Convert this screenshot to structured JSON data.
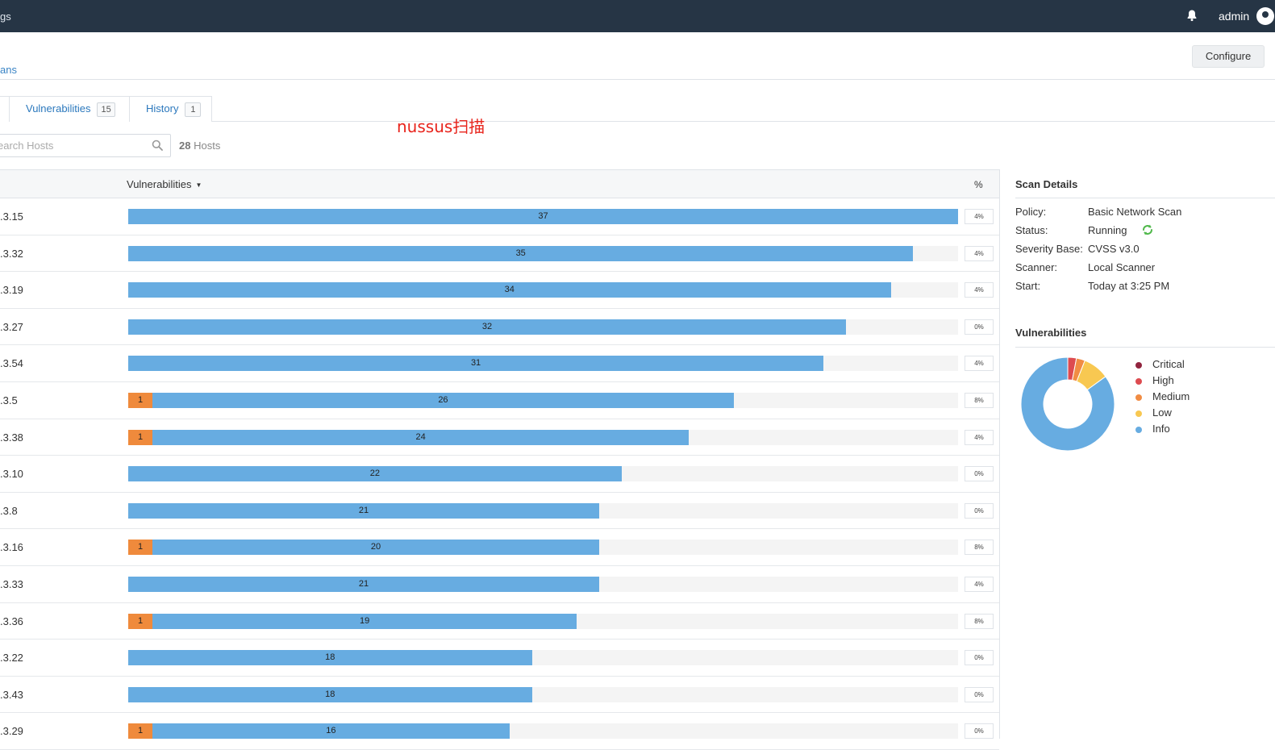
{
  "topbar": {
    "left_text": "gs",
    "user": "admin"
  },
  "breadcrumb": "ans",
  "configure_label": "Configure",
  "tabs": [
    {
      "label": "Vulnerabilities",
      "count": "15"
    },
    {
      "label": "History",
      "count": "1"
    }
  ],
  "annotation": "nussus扫描",
  "search": {
    "placeholder": "earch Hosts"
  },
  "hosts_summary": {
    "count": "28",
    "label": "Hosts"
  },
  "table": {
    "col_vulnerabilities": "Vulnerabilities",
    "col_pct": "%",
    "max_value": 37,
    "rows": [
      {
        "host": ".3.15",
        "medium": null,
        "info": 37,
        "pct": "4%"
      },
      {
        "host": ".3.32",
        "medium": null,
        "info": 35,
        "pct": "4%"
      },
      {
        "host": ".3.19",
        "medium": null,
        "info": 34,
        "pct": "4%"
      },
      {
        "host": ".3.27",
        "medium": null,
        "info": 32,
        "pct": "0%"
      },
      {
        "host": ".3.54",
        "medium": null,
        "info": 31,
        "pct": "4%"
      },
      {
        "host": ".3.5",
        "medium": 1,
        "info": 26,
        "pct": "8%"
      },
      {
        "host": ".3.38",
        "medium": 1,
        "info": 24,
        "pct": "4%"
      },
      {
        "host": ".3.10",
        "medium": null,
        "info": 22,
        "pct": "0%"
      },
      {
        "host": ".3.8",
        "medium": null,
        "info": 21,
        "pct": "0%"
      },
      {
        "host": ".3.16",
        "medium": 1,
        "info": 20,
        "pct": "8%"
      },
      {
        "host": ".3.33",
        "medium": null,
        "info": 21,
        "pct": "4%"
      },
      {
        "host": ".3.36",
        "medium": 1,
        "info": 19,
        "pct": "8%"
      },
      {
        "host": ".3.22",
        "medium": null,
        "info": 18,
        "pct": "0%"
      },
      {
        "host": ".3.43",
        "medium": null,
        "info": 18,
        "pct": "0%"
      },
      {
        "host": ".3.29",
        "medium": 1,
        "info": 16,
        "pct": "0%"
      }
    ]
  },
  "scan_details": {
    "title": "Scan Details",
    "items": [
      {
        "key": "Policy:",
        "value": "Basic Network Scan"
      },
      {
        "key": "Status:",
        "value": "Running"
      },
      {
        "key": "Severity Base:",
        "value": "CVSS v3.0"
      },
      {
        "key": "Scanner:",
        "value": "Local Scanner"
      },
      {
        "key": "Start:",
        "value": "Today at 3:25 PM"
      }
    ]
  },
  "vulnerabilities_panel": {
    "title": "Vulnerabilities",
    "legend": [
      {
        "label": "Critical",
        "color": "#91243e",
        "share": 0
      },
      {
        "label": "High",
        "color": "#dd4b50",
        "share": 0.03
      },
      {
        "label": "Medium",
        "color": "#f18c43",
        "share": 0.03
      },
      {
        "label": "Low",
        "color": "#f8c851",
        "share": 0.09
      },
      {
        "label": "Info",
        "color": "#67ace1",
        "share": 0.85
      }
    ]
  }
}
